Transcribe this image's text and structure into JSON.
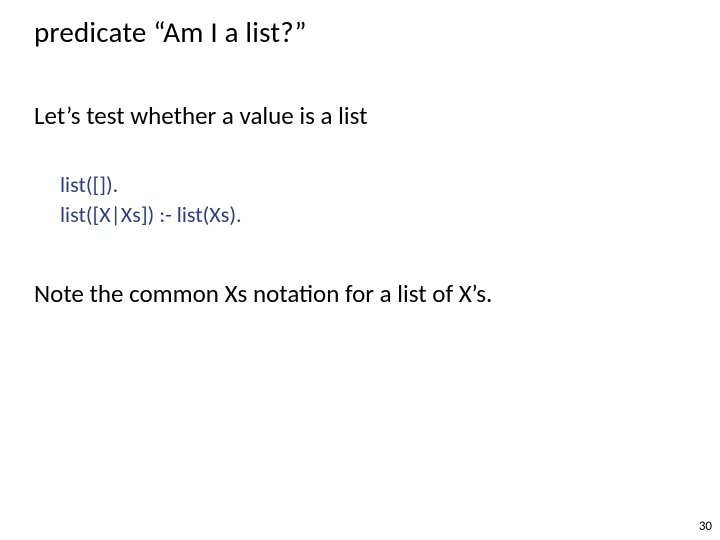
{
  "title": "predicate “Am I a list?”",
  "intro": "Let’s test whether a value is a list",
  "code_line1": "list([]).",
  "code_line2": "list([X|Xs]) :- list(Xs).",
  "note": "Note the common Xs notation for a list of X’s.",
  "page_number": "30"
}
